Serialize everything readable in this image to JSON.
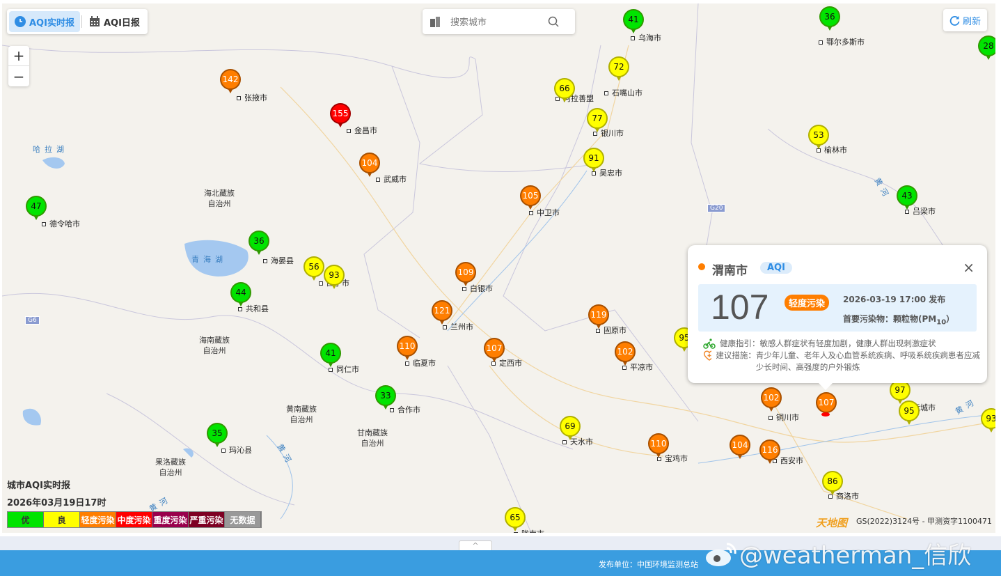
{
  "tabs": [
    {
      "label": "AQI实时报",
      "icon": "clock-icon",
      "active": true
    },
    {
      "label": "AQI日报",
      "icon": "calendar-icon",
      "active": false
    }
  ],
  "search": {
    "placeholder": "搜索城市",
    "icon": "search-icon",
    "left_icon": "building-icon"
  },
  "zoom": {
    "in": "+",
    "out": "−"
  },
  "refresh": {
    "label": "刷新",
    "icon": "refresh-icon"
  },
  "colors": {
    "good": "#00e400",
    "moderate": "#ffff00",
    "light": "#ff7e00",
    "medium": "#ff0000",
    "heavy": "#99004c",
    "severe": "#7e0023",
    "nodata": "#999999",
    "accent": "#2f8de4"
  },
  "markers": [
    {
      "aqi": "142",
      "city": "张掖市",
      "level": "light"
    },
    {
      "aqi": "155",
      "city": "金昌市",
      "level": "medium"
    },
    {
      "aqi": "104",
      "city": "武威市",
      "level": "light"
    },
    {
      "aqi": "47",
      "city": "德令哈市",
      "level": "good"
    },
    {
      "aqi": "36",
      "city": "海晏县",
      "level": "good"
    },
    {
      "aqi": "56",
      "city": "西宁市",
      "level": "moderate"
    },
    {
      "aqi": "93",
      "city": "",
      "level": "moderate"
    },
    {
      "aqi": "44",
      "city": "共和县",
      "level": "good"
    },
    {
      "aqi": "41",
      "city": "同仁市",
      "level": "good"
    },
    {
      "aqi": "33",
      "city": "合作市",
      "level": "good"
    },
    {
      "aqi": "35",
      "city": "玛沁县",
      "level": "good"
    },
    {
      "aqi": "110",
      "city": "临夏市",
      "level": "light"
    },
    {
      "aqi": "121",
      "city": "兰州市",
      "level": "light"
    },
    {
      "aqi": "109",
      "city": "白银市",
      "level": "light"
    },
    {
      "aqi": "107",
      "city": "定西市",
      "level": "light"
    },
    {
      "aqi": "105",
      "city": "中卫市",
      "level": "light"
    },
    {
      "aqi": "91",
      "city": "吴忠市",
      "level": "moderate"
    },
    {
      "aqi": "77",
      "city": "银川市",
      "level": "moderate"
    },
    {
      "aqi": "66",
      "city": "阿拉善盟",
      "level": "moderate"
    },
    {
      "aqi": "72",
      "city": "石嘴山市",
      "level": "moderate"
    },
    {
      "aqi": "41",
      "city": "乌海市",
      "level": "good"
    },
    {
      "aqi": "36",
      "city": "鄂尔多斯市",
      "level": "good"
    },
    {
      "aqi": "28",
      "city": "",
      "level": "good"
    },
    {
      "aqi": "53",
      "city": "榆林市",
      "level": "moderate"
    },
    {
      "aqi": "43",
      "city": "吕梁市",
      "level": "good"
    },
    {
      "aqi": "119",
      "city": "固原市",
      "level": "light"
    },
    {
      "aqi": "102",
      "city": "平凉市",
      "level": "light"
    },
    {
      "aqi": "95",
      "city": "",
      "level": "moderate"
    },
    {
      "aqi": "69",
      "city": "天水市",
      "level": "moderate"
    },
    {
      "aqi": "110",
      "city": "宝鸡市",
      "level": "light"
    },
    {
      "aqi": "104",
      "city": "",
      "level": "light"
    },
    {
      "aqi": "116",
      "city": "西安市",
      "level": "light"
    },
    {
      "aqi": "102",
      "city": "铜川市",
      "level": "light"
    },
    {
      "aqi": "107",
      "city": "",
      "level": "light"
    },
    {
      "aqi": "97",
      "city": "",
      "level": "moderate"
    },
    {
      "aqi": "95",
      "city": "运城市",
      "level": "moderate"
    },
    {
      "aqi": "93",
      "city": "",
      "level": "moderate"
    },
    {
      "aqi": "86",
      "city": "商洛市",
      "level": "moderate"
    },
    {
      "aqi": "65",
      "city": "陇南市",
      "level": "moderate"
    }
  ],
  "regions": [
    "海北藏族\n自治州",
    "海南藏族\n自治州",
    "黄南藏族\n自治州",
    "甘南藏族\n自治州",
    "果洛藏族\n自治州"
  ],
  "water": [
    "哈拉湖",
    "青海湖",
    "黄河",
    "黄河",
    "黄河",
    "黄河"
  ],
  "roads": [
    "G6",
    "G20"
  ],
  "popup": {
    "city": "渭南市",
    "badge": "AQI",
    "aqi": "107",
    "level": "轻度污染",
    "time": "2026-03-19 17:00 发布",
    "pollutant_label": "首要污染物：颗粒物(PM",
    "pollutant_sub": "10",
    "pollutant_end": "）",
    "health_label": "健康指引：",
    "health": "敏感人群症状有轻度加剧，健康人群出现刺激症状",
    "advice_label": "建议措施：",
    "advice": "青少年儿童、老年人及心血管系统疾病、呼吸系统疾病患者应减少长时间、高强度的户外锻炼",
    "close": "×"
  },
  "info": {
    "title": "城市AQI实时报",
    "time": "2026年03月19日17时"
  },
  "legend": [
    {
      "label": "优",
      "color": "#00e400",
      "text": "#333"
    },
    {
      "label": "良",
      "color": "#ffff00",
      "text": "#333"
    },
    {
      "label": "轻度污染",
      "color": "#ff7e00",
      "text": "#fff"
    },
    {
      "label": "中度污染",
      "color": "#ff0000",
      "text": "#fff"
    },
    {
      "label": "重度污染",
      "color": "#99004c",
      "text": "#fff"
    },
    {
      "label": "严重污染",
      "color": "#7e0023",
      "text": "#fff"
    },
    {
      "label": "无数据",
      "color": "#999999",
      "text": "#fff"
    }
  ],
  "copyright": "GS(2022)3124号 - 甲测资字1100471",
  "logo": "天地图",
  "footer": {
    "publisher": "发布单位：中国环境监测总站",
    "watermark": "@weatherman_信欣",
    "toggle": "^"
  }
}
